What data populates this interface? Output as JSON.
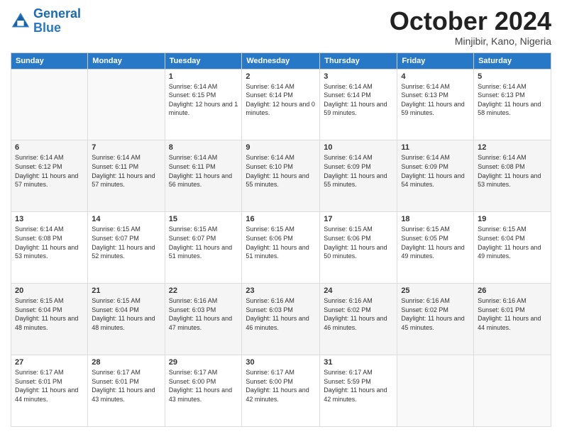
{
  "logo": {
    "text_general": "General",
    "text_blue": "Blue"
  },
  "header": {
    "month": "October 2024",
    "location": "Minjibir, Kano, Nigeria"
  },
  "days_of_week": [
    "Sunday",
    "Monday",
    "Tuesday",
    "Wednesday",
    "Thursday",
    "Friday",
    "Saturday"
  ],
  "weeks": [
    [
      {
        "day": "",
        "sunrise": "",
        "sunset": "",
        "daylight": ""
      },
      {
        "day": "",
        "sunrise": "",
        "sunset": "",
        "daylight": ""
      },
      {
        "day": "1",
        "sunrise": "Sunrise: 6:14 AM",
        "sunset": "Sunset: 6:15 PM",
        "daylight": "Daylight: 12 hours and 1 minute."
      },
      {
        "day": "2",
        "sunrise": "Sunrise: 6:14 AM",
        "sunset": "Sunset: 6:14 PM",
        "daylight": "Daylight: 12 hours and 0 minutes."
      },
      {
        "day": "3",
        "sunrise": "Sunrise: 6:14 AM",
        "sunset": "Sunset: 6:14 PM",
        "daylight": "Daylight: 11 hours and 59 minutes."
      },
      {
        "day": "4",
        "sunrise": "Sunrise: 6:14 AM",
        "sunset": "Sunset: 6:13 PM",
        "daylight": "Daylight: 11 hours and 59 minutes."
      },
      {
        "day": "5",
        "sunrise": "Sunrise: 6:14 AM",
        "sunset": "Sunset: 6:13 PM",
        "daylight": "Daylight: 11 hours and 58 minutes."
      }
    ],
    [
      {
        "day": "6",
        "sunrise": "Sunrise: 6:14 AM",
        "sunset": "Sunset: 6:12 PM",
        "daylight": "Daylight: 11 hours and 57 minutes."
      },
      {
        "day": "7",
        "sunrise": "Sunrise: 6:14 AM",
        "sunset": "Sunset: 6:11 PM",
        "daylight": "Daylight: 11 hours and 57 minutes."
      },
      {
        "day": "8",
        "sunrise": "Sunrise: 6:14 AM",
        "sunset": "Sunset: 6:11 PM",
        "daylight": "Daylight: 11 hours and 56 minutes."
      },
      {
        "day": "9",
        "sunrise": "Sunrise: 6:14 AM",
        "sunset": "Sunset: 6:10 PM",
        "daylight": "Daylight: 11 hours and 55 minutes."
      },
      {
        "day": "10",
        "sunrise": "Sunrise: 6:14 AM",
        "sunset": "Sunset: 6:09 PM",
        "daylight": "Daylight: 11 hours and 55 minutes."
      },
      {
        "day": "11",
        "sunrise": "Sunrise: 6:14 AM",
        "sunset": "Sunset: 6:09 PM",
        "daylight": "Daylight: 11 hours and 54 minutes."
      },
      {
        "day": "12",
        "sunrise": "Sunrise: 6:14 AM",
        "sunset": "Sunset: 6:08 PM",
        "daylight": "Daylight: 11 hours and 53 minutes."
      }
    ],
    [
      {
        "day": "13",
        "sunrise": "Sunrise: 6:14 AM",
        "sunset": "Sunset: 6:08 PM",
        "daylight": "Daylight: 11 hours and 53 minutes."
      },
      {
        "day": "14",
        "sunrise": "Sunrise: 6:15 AM",
        "sunset": "Sunset: 6:07 PM",
        "daylight": "Daylight: 11 hours and 52 minutes."
      },
      {
        "day": "15",
        "sunrise": "Sunrise: 6:15 AM",
        "sunset": "Sunset: 6:07 PM",
        "daylight": "Daylight: 11 hours and 51 minutes."
      },
      {
        "day": "16",
        "sunrise": "Sunrise: 6:15 AM",
        "sunset": "Sunset: 6:06 PM",
        "daylight": "Daylight: 11 hours and 51 minutes."
      },
      {
        "day": "17",
        "sunrise": "Sunrise: 6:15 AM",
        "sunset": "Sunset: 6:06 PM",
        "daylight": "Daylight: 11 hours and 50 minutes."
      },
      {
        "day": "18",
        "sunrise": "Sunrise: 6:15 AM",
        "sunset": "Sunset: 6:05 PM",
        "daylight": "Daylight: 11 hours and 49 minutes."
      },
      {
        "day": "19",
        "sunrise": "Sunrise: 6:15 AM",
        "sunset": "Sunset: 6:04 PM",
        "daylight": "Daylight: 11 hours and 49 minutes."
      }
    ],
    [
      {
        "day": "20",
        "sunrise": "Sunrise: 6:15 AM",
        "sunset": "Sunset: 6:04 PM",
        "daylight": "Daylight: 11 hours and 48 minutes."
      },
      {
        "day": "21",
        "sunrise": "Sunrise: 6:15 AM",
        "sunset": "Sunset: 6:04 PM",
        "daylight": "Daylight: 11 hours and 48 minutes."
      },
      {
        "day": "22",
        "sunrise": "Sunrise: 6:16 AM",
        "sunset": "Sunset: 6:03 PM",
        "daylight": "Daylight: 11 hours and 47 minutes."
      },
      {
        "day": "23",
        "sunrise": "Sunrise: 6:16 AM",
        "sunset": "Sunset: 6:03 PM",
        "daylight": "Daylight: 11 hours and 46 minutes."
      },
      {
        "day": "24",
        "sunrise": "Sunrise: 6:16 AM",
        "sunset": "Sunset: 6:02 PM",
        "daylight": "Daylight: 11 hours and 46 minutes."
      },
      {
        "day": "25",
        "sunrise": "Sunrise: 6:16 AM",
        "sunset": "Sunset: 6:02 PM",
        "daylight": "Daylight: 11 hours and 45 minutes."
      },
      {
        "day": "26",
        "sunrise": "Sunrise: 6:16 AM",
        "sunset": "Sunset: 6:01 PM",
        "daylight": "Daylight: 11 hours and 44 minutes."
      }
    ],
    [
      {
        "day": "27",
        "sunrise": "Sunrise: 6:17 AM",
        "sunset": "Sunset: 6:01 PM",
        "daylight": "Daylight: 11 hours and 44 minutes."
      },
      {
        "day": "28",
        "sunrise": "Sunrise: 6:17 AM",
        "sunset": "Sunset: 6:01 PM",
        "daylight": "Daylight: 11 hours and 43 minutes."
      },
      {
        "day": "29",
        "sunrise": "Sunrise: 6:17 AM",
        "sunset": "Sunset: 6:00 PM",
        "daylight": "Daylight: 11 hours and 43 minutes."
      },
      {
        "day": "30",
        "sunrise": "Sunrise: 6:17 AM",
        "sunset": "Sunset: 6:00 PM",
        "daylight": "Daylight: 11 hours and 42 minutes."
      },
      {
        "day": "31",
        "sunrise": "Sunrise: 6:17 AM",
        "sunset": "Sunset: 5:59 PM",
        "daylight": "Daylight: 11 hours and 42 minutes."
      },
      {
        "day": "",
        "sunrise": "",
        "sunset": "",
        "daylight": ""
      },
      {
        "day": "",
        "sunrise": "",
        "sunset": "",
        "daylight": ""
      }
    ]
  ]
}
